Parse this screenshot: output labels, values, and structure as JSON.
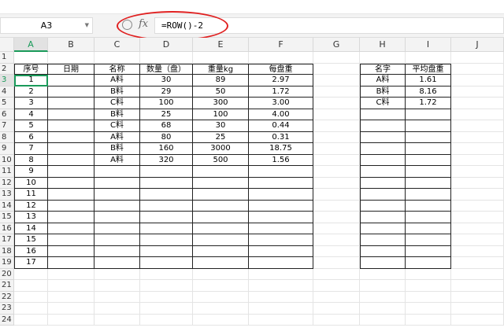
{
  "name_box": "A3",
  "formula": "=ROW()-2",
  "columns": [
    "A",
    "B",
    "C",
    "D",
    "E",
    "F",
    "G",
    "H",
    "I",
    "J"
  ],
  "row_count": 24,
  "main_table": {
    "headers": [
      "序号",
      "日期",
      "名称",
      "数量（盘）",
      "重量kg",
      "每盘重"
    ],
    "rows": [
      [
        "1",
        "",
        "A料",
        "30",
        "89",
        "2.97"
      ],
      [
        "2",
        "",
        "B料",
        "29",
        "50",
        "1.72"
      ],
      [
        "3",
        "",
        "C料",
        "100",
        "300",
        "3.00"
      ],
      [
        "4",
        "",
        "B料",
        "25",
        "100",
        "4.00"
      ],
      [
        "5",
        "",
        "C料",
        "68",
        "30",
        "0.44"
      ],
      [
        "6",
        "",
        "A料",
        "80",
        "25",
        "0.31"
      ],
      [
        "7",
        "",
        "B料",
        "160",
        "3000",
        "18.75"
      ],
      [
        "8",
        "",
        "A料",
        "320",
        "500",
        "1.56"
      ],
      [
        "9",
        "",
        "",
        "",
        "",
        ""
      ],
      [
        "10",
        "",
        "",
        "",
        "",
        ""
      ],
      [
        "11",
        "",
        "",
        "",
        "",
        ""
      ],
      [
        "12",
        "",
        "",
        "",
        "",
        ""
      ],
      [
        "13",
        "",
        "",
        "",
        "",
        ""
      ],
      [
        "14",
        "",
        "",
        "",
        "",
        ""
      ],
      [
        "15",
        "",
        "",
        "",
        "",
        ""
      ],
      [
        "16",
        "",
        "",
        "",
        "",
        ""
      ],
      [
        "17",
        "",
        "",
        "",
        "",
        ""
      ]
    ]
  },
  "side_table": {
    "headers": [
      "名字",
      "平均盘重"
    ],
    "rows": [
      [
        "A料",
        "1.61"
      ],
      [
        "B料",
        "8.16"
      ],
      [
        "C料",
        "1.72"
      ],
      [
        "",
        ""
      ],
      [
        "",
        ""
      ],
      [
        "",
        ""
      ],
      [
        "",
        ""
      ],
      [
        "",
        ""
      ],
      [
        "",
        ""
      ],
      [
        "",
        ""
      ],
      [
        "",
        ""
      ],
      [
        "",
        ""
      ],
      [
        "",
        ""
      ],
      [
        "",
        ""
      ],
      [
        "",
        ""
      ],
      [
        "",
        ""
      ],
      [
        "",
        ""
      ]
    ]
  },
  "selected_cell": "A3",
  "accent": "#1a9a5a",
  "highlight": "#e02020"
}
